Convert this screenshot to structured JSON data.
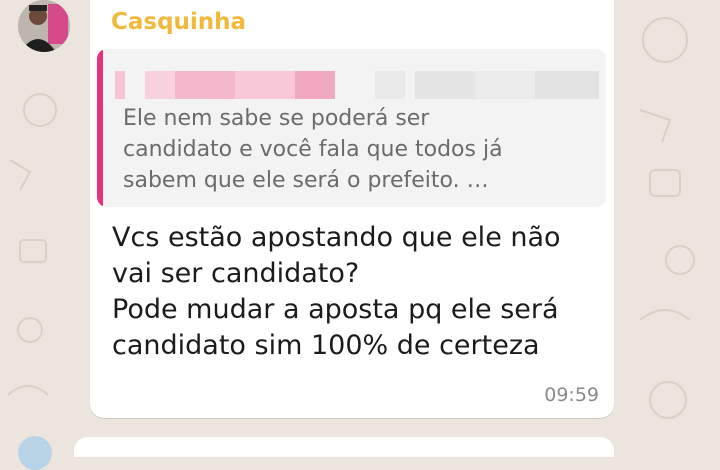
{
  "chat": {
    "sender_name": "Casquinha",
    "sender_color": "#f0b93c",
    "quoted": {
      "accent_color": "#e6307e",
      "lines": [
        "Ele nem sabe se poderá ser",
        "candidato e você fala que todos já",
        "sabem que ele será o prefeito. …"
      ]
    },
    "message_lines": [
      "Vcs estão apostando que ele não",
      "vai ser candidato?",
      "Pode mudar a aposta pq ele será",
      "candidato sim 100% de certeza"
    ],
    "timestamp": "09:59"
  }
}
